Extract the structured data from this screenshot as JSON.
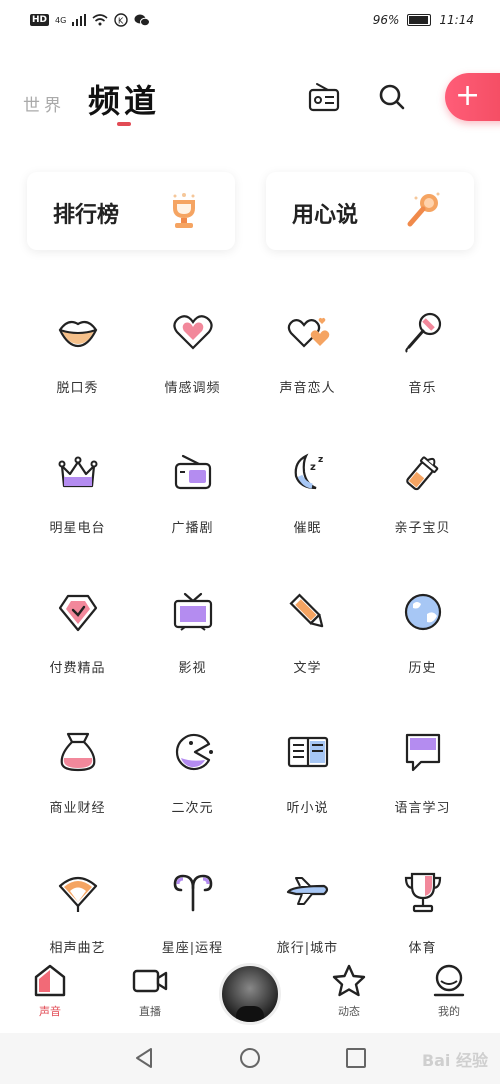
{
  "status_bar": {
    "left_badge": "HD",
    "network": "4G",
    "battery": "96%",
    "time": "11:14"
  },
  "header": {
    "tab_world": "世界",
    "tab_channel": "频道",
    "icons": [
      "radio-icon",
      "search-icon",
      "add-icon"
    ]
  },
  "cards": [
    {
      "label": "排行榜",
      "icon": "trophy-icon"
    },
    {
      "label": "用心说",
      "icon": "microphone-icon"
    }
  ],
  "categories": [
    {
      "label": "脱口秀",
      "icon": "lips-icon"
    },
    {
      "label": "情感调频",
      "icon": "heart-icon"
    },
    {
      "label": "声音恋人",
      "icon": "two-hearts-icon"
    },
    {
      "label": "音乐",
      "icon": "microphone-icon"
    },
    {
      "label": "明星电台",
      "icon": "crown-icon"
    },
    {
      "label": "广播剧",
      "icon": "radio-icon"
    },
    {
      "label": "催眠",
      "icon": "moon-sleep-icon"
    },
    {
      "label": "亲子宝贝",
      "icon": "baby-bottle-icon"
    },
    {
      "label": "付费精品",
      "icon": "diamond-icon"
    },
    {
      "label": "影视",
      "icon": "tv-icon"
    },
    {
      "label": "文学",
      "icon": "pencil-icon"
    },
    {
      "label": "历史",
      "icon": "globe-icon"
    },
    {
      "label": "商业财经",
      "icon": "money-bag-icon"
    },
    {
      "label": "二次元",
      "icon": "pacman-icon"
    },
    {
      "label": "听小说",
      "icon": "book-icon"
    },
    {
      "label": "语言学习",
      "icon": "speech-bubble-icon"
    },
    {
      "label": "相声曲艺",
      "icon": "fan-icon"
    },
    {
      "label": "星座|运程",
      "icon": "aries-icon"
    },
    {
      "label": "旅行|城市",
      "icon": "airplane-icon"
    },
    {
      "label": "体育",
      "icon": "cup-icon"
    }
  ],
  "bottom_nav": [
    {
      "label": "声音",
      "active": true
    },
    {
      "label": "直播",
      "active": false
    },
    {
      "label": "",
      "active": false
    },
    {
      "label": "动态",
      "active": false
    },
    {
      "label": "我的",
      "active": false
    }
  ],
  "watermark": "Bai 经验",
  "colors": {
    "accent": "#e24b55",
    "purple": "#b48cf0",
    "orange": "#f5a462",
    "pink": "#f2889b"
  }
}
